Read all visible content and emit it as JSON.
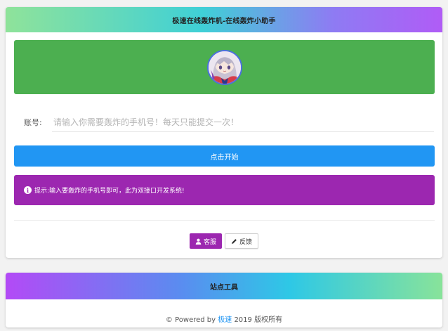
{
  "header": {
    "title": "极速在线轰炸机-在线轰炸小助手"
  },
  "form": {
    "account_label": "账号:",
    "account_placeholder": "请输入你需要轰炸的手机号！每天只能提交一次！",
    "account_value": ""
  },
  "actions": {
    "start_label": "点击开始"
  },
  "tip": {
    "text": "提示:输入要轰炸的手机号即可，此为双接口开发系统!"
  },
  "buttons": {
    "service_label": "客服",
    "feedback_label": "反馈"
  },
  "footer": {
    "tools_title": "站点工具",
    "powered_prefix": "© Powered by",
    "brand": "极速",
    "powered_suffix": "2019 版权所有"
  },
  "colors": {
    "avatar_panel": "#4caf50",
    "start_button": "#2196f3",
    "tip_box": "#9c27b0",
    "service_button": "#9c27b0"
  },
  "icons": {
    "info": "info-circle-icon",
    "user": "user-icon",
    "pencil": "pencil-icon"
  }
}
